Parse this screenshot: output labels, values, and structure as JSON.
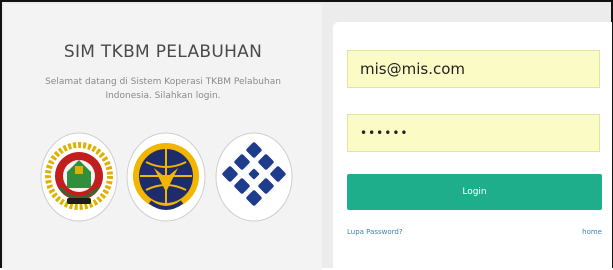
{
  "brand": {
    "title": "SIM TKBM PELABUHAN",
    "welcome": "Selamat datang di Sistem Koperasi TKBM Pelabuhan Indonesia. Silahkan login."
  },
  "logos": [
    "koperasi-emblem-icon",
    "ministry-of-transportation-emblem-icon",
    "ministry-of-manpower-emblem-icon"
  ],
  "login_form": {
    "email_value": "mis@mis.com",
    "password_value": "••••••",
    "login_label": "Login",
    "forgot_label": "Lupa Password?",
    "home_label": "home"
  },
  "colors": {
    "accent": "#1fae8b",
    "input_bg": "#fbfbc6",
    "link": "#3d82b5"
  }
}
